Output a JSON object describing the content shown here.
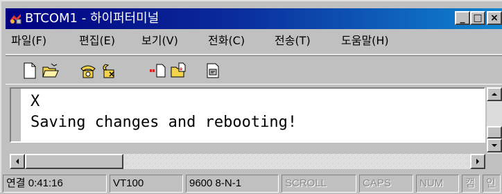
{
  "window": {
    "title": "BTCOM1 - 하이퍼터미널",
    "controls": {
      "minimize": "_",
      "maximize": "□",
      "close": "×"
    }
  },
  "menu": {
    "items": [
      {
        "label": "파일(F)"
      },
      {
        "label": "편집(E)"
      },
      {
        "label": "보기(V)"
      },
      {
        "label": "전화(C)"
      },
      {
        "label": "전송(T)"
      },
      {
        "label": "도움말(H)"
      }
    ]
  },
  "toolbar": {
    "buttons": [
      {
        "icon": "new-document-icon"
      },
      {
        "icon": "open-folder-icon"
      },
      {
        "icon": "call-phone-icon"
      },
      {
        "icon": "disconnect-phone-icon"
      },
      {
        "icon": "send-file-icon"
      },
      {
        "icon": "receive-file-icon"
      },
      {
        "icon": "properties-icon"
      }
    ]
  },
  "terminal": {
    "lines": [
      "X",
      "Saving changes and rebooting!"
    ]
  },
  "statusbar": {
    "connection": "연결 0:41:16",
    "emulation": "VT100",
    "port_settings": "9600 8-N-1",
    "scroll": "SCROLL",
    "caps": "CAPS",
    "num": "NUM",
    "capture": "캡",
    "print": "인"
  },
  "colors": {
    "title_start": "#000080",
    "title_end": "#1084d0",
    "chrome": "#c0c0c0"
  }
}
